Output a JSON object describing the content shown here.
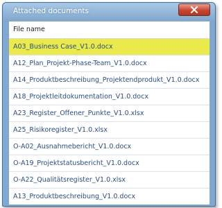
{
  "window": {
    "title": "Attached documents"
  },
  "list": {
    "header": "File name",
    "selected_index": 0,
    "items": [
      "A03_Business Case_V1.0.docx",
      "A12_Plan_Projekt-Phase-Team_V1.0.docx",
      "A14_Produktbeschreibung_Projektendprodukt_V1.0.docx",
      "A18_Projektleitdokumentation_V1.0.docx",
      "A23_Register_Offener_Punkte_V1.0.xlsx",
      "A25_Risikoregister_V1.0.xlsx",
      "O-A02_Ausnahmebericht_V1.0.docx",
      "O-A19_Projektstatusbericht_V1.0.docx",
      "O-A22_Qualitätsregister_V1.0.xlsx",
      "A13_Produktbeschreibung_V1.0.docx"
    ]
  },
  "colors": {
    "selected_row": "#eaea4a",
    "link_text": "#2a4e85",
    "close_button": "#c8462f"
  },
  "icons": {
    "close": "close-icon"
  }
}
